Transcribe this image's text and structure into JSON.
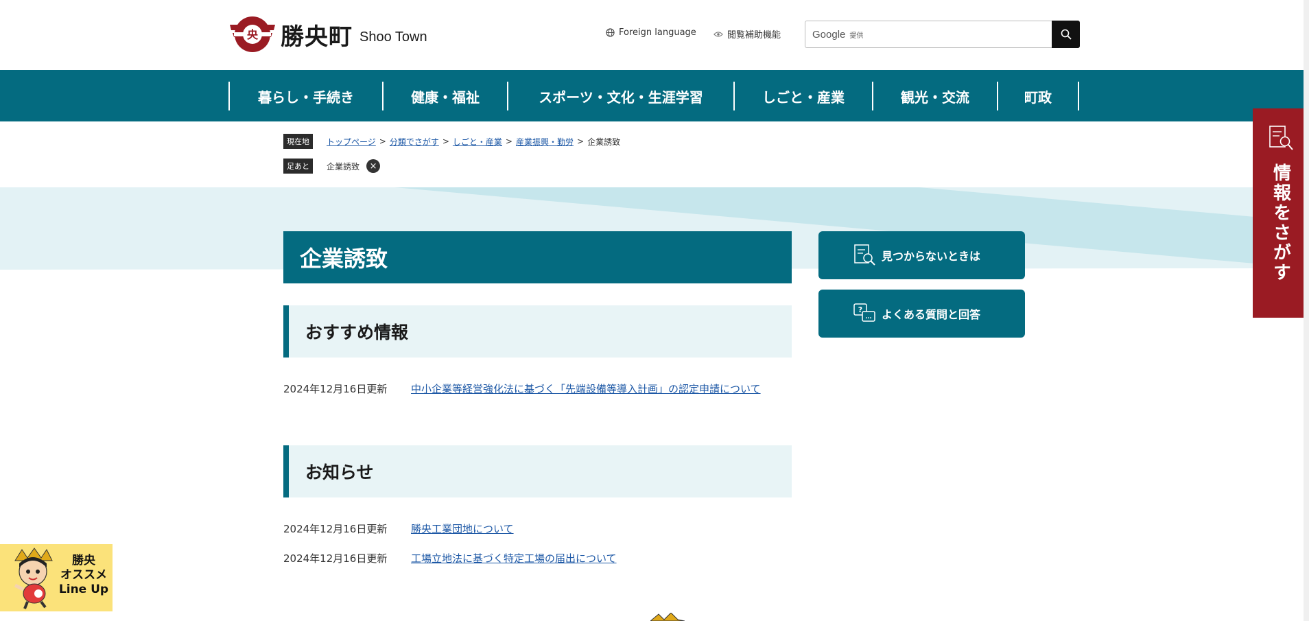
{
  "header": {
    "logo_jp": "勝央町",
    "logo_en": "Shoo Town",
    "foreign_language": "Foreign language",
    "accessibility": "閲覧補助機能",
    "search": {
      "google": "Google",
      "provided": "提供",
      "icon": "search-icon"
    }
  },
  "gnav": {
    "items": [
      {
        "label": "暮らし・手続き"
      },
      {
        "label": "健康・福祉"
      },
      {
        "label": "スポーツ・文化・生涯学習"
      },
      {
        "label": "しごと・産業"
      },
      {
        "label": "観光・交流"
      },
      {
        "label": "町政"
      }
    ]
  },
  "breadcrumb": {
    "label": "現在地",
    "links": [
      "トップページ",
      "分類でさがす",
      "しごと・産業",
      "産業振興・勤労"
    ],
    "separator": ">",
    "current": "企業誘致"
  },
  "footprint": {
    "label": "足あと",
    "item": "企業誘致"
  },
  "main": {
    "title": "企業誘致",
    "recommended": {
      "heading": "おすすめ情報",
      "items": [
        {
          "date": "2024年12月16日更新",
          "title": "中小企業等経営強化法に基づく「先端設備等導入計画」の認定申請について"
        }
      ]
    },
    "news": {
      "heading": "お知らせ",
      "items": [
        {
          "date": "2024年12月16日更新",
          "title": "勝央工業団地について"
        },
        {
          "date": "2024年12月16日更新",
          "title": "工場立地法に基づく特定工場の届出について"
        }
      ]
    }
  },
  "side": {
    "not_found": "見つからないときは",
    "faq": "よくある質問と回答"
  },
  "info_tab": {
    "label": "情報をさがす"
  },
  "banner": {
    "line1": "勝央",
    "line2": "オススメ",
    "line3": "Line Up"
  },
  "colors": {
    "primary": "#046b80",
    "accent_red": "#9a1b23",
    "link": "#1d58a6",
    "banner": "#fbe27a"
  }
}
